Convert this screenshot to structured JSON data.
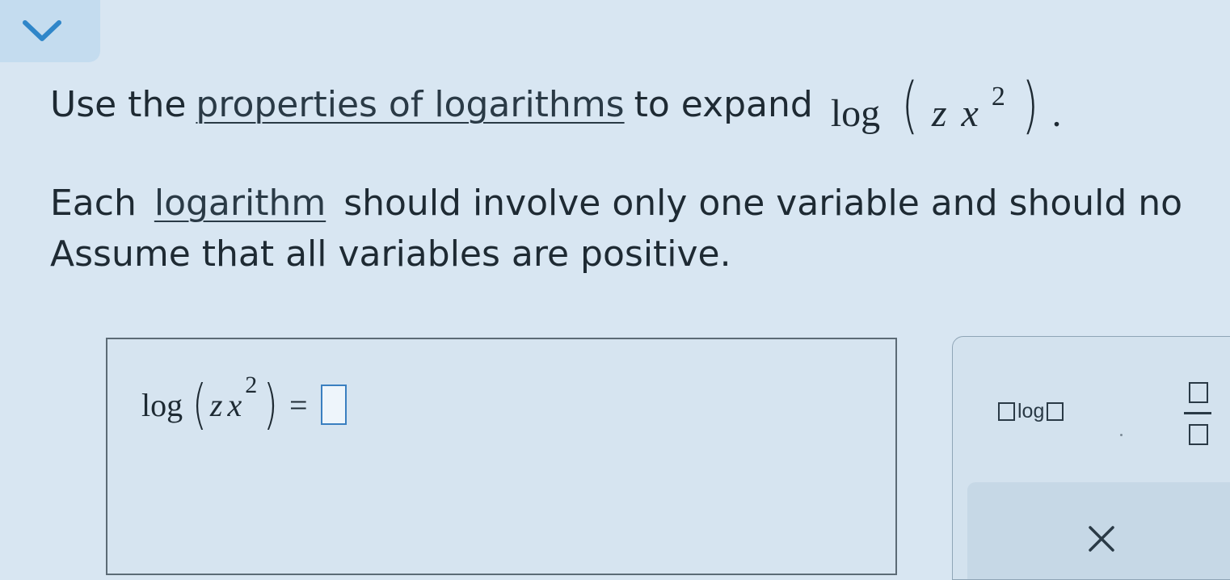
{
  "header": {
    "collapse_icon": "chevron-down-icon",
    "accent": "#2f86c9"
  },
  "question": {
    "line1": {
      "prefix": "Use the",
      "link_text": "properties of logarithms",
      "middle": "to expand"
    },
    "expression": {
      "func": "log",
      "open": "(",
      "var1": "z",
      "var2": "x",
      "exponent": "2",
      "close": ")",
      "period": "."
    },
    "line2": {
      "prefix": "Each",
      "link_text": "logarithm",
      "suffix": "should involve only one variable and should no"
    },
    "line3": "Assume that all variables are positive."
  },
  "answer": {
    "lhs": {
      "func": "log",
      "open": "(",
      "var1": "z",
      "var2": "x",
      "exponent": "2",
      "close": ")"
    },
    "equals": "=",
    "value": ""
  },
  "palette": {
    "log_button": {
      "label": "log",
      "icon": "log-template-icon"
    },
    "fraction_button": {
      "icon": "fraction-template-icon"
    },
    "clear_button": {
      "icon": "close-icon"
    }
  }
}
